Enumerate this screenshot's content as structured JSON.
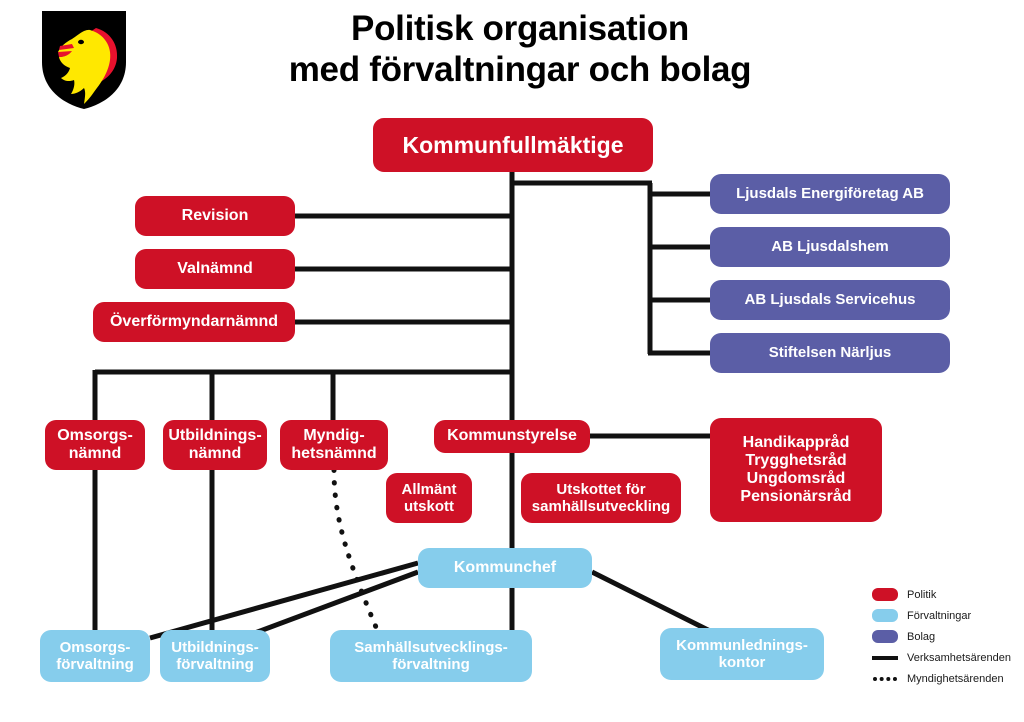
{
  "title": {
    "line1": "Politisk organisation",
    "line2": "med förvaltningar och bolag"
  },
  "crest": {
    "name": "ljusdal-municipal-coat-of-arms",
    "shield_color": "#000000",
    "charge_color": "#FFE800",
    "mane_color": "#E8112D"
  },
  "colors": {
    "politik": "#CE1126",
    "forvaltningar": "#86CDEC",
    "bolag": "#5B5EA6",
    "connector": "#111111"
  },
  "nodes": {
    "kommunfullmaktige": "Kommunfullmäktige",
    "revision": "Revision",
    "valnamnd": "Valnämnd",
    "overformyndarnamnd": "Överförmyndarnämnd",
    "omsorgsnamnd": "Omsorgs-\nnämnd",
    "utbildningsnamnd": "Utbildnings-\nnämnd",
    "myndighetsnamnd": "Myndig-\nhetsnämnd",
    "kommunstyrelse": "Kommunstyrelse",
    "allmant_utskott": "Allmänt\nutskott",
    "utskottet_samhallsutveckling": "Utskottet för\nsamhällsutveckling",
    "rad": "Handikappråd\nTrygghetsråd\nUngdomsråd\nPensionärsråd",
    "energiforetag": "Ljusdals Energiföretag AB",
    "ljusdalshem": "AB Ljusdalshem",
    "servicehus": "AB Ljusdals Servicehus",
    "narljus": "Stiftelsen Närljus",
    "kommunchef": "Kommunchef",
    "omsorgsforvaltning": "Omsorgs-\nförvaltning",
    "utbildningsforvaltning": "Utbildnings-\nförvaltning",
    "samhallsutvecklingsforvaltning": "Samhällsutvecklings-\nförvaltning",
    "kommunledningskontor": "Kommunlednings-\nkontor"
  },
  "legend": {
    "items": [
      {
        "label": "Politik",
        "kind": "swatch",
        "color": "#CE1126"
      },
      {
        "label": "Förvaltningar",
        "kind": "swatch",
        "color": "#86CDEC"
      },
      {
        "label": "Bolag",
        "kind": "swatch",
        "color": "#5B5EA6"
      },
      {
        "label": "Verksamhetsärenden",
        "kind": "solid-line"
      },
      {
        "label": "Myndighetsärenden",
        "kind": "dotted-line"
      }
    ]
  }
}
